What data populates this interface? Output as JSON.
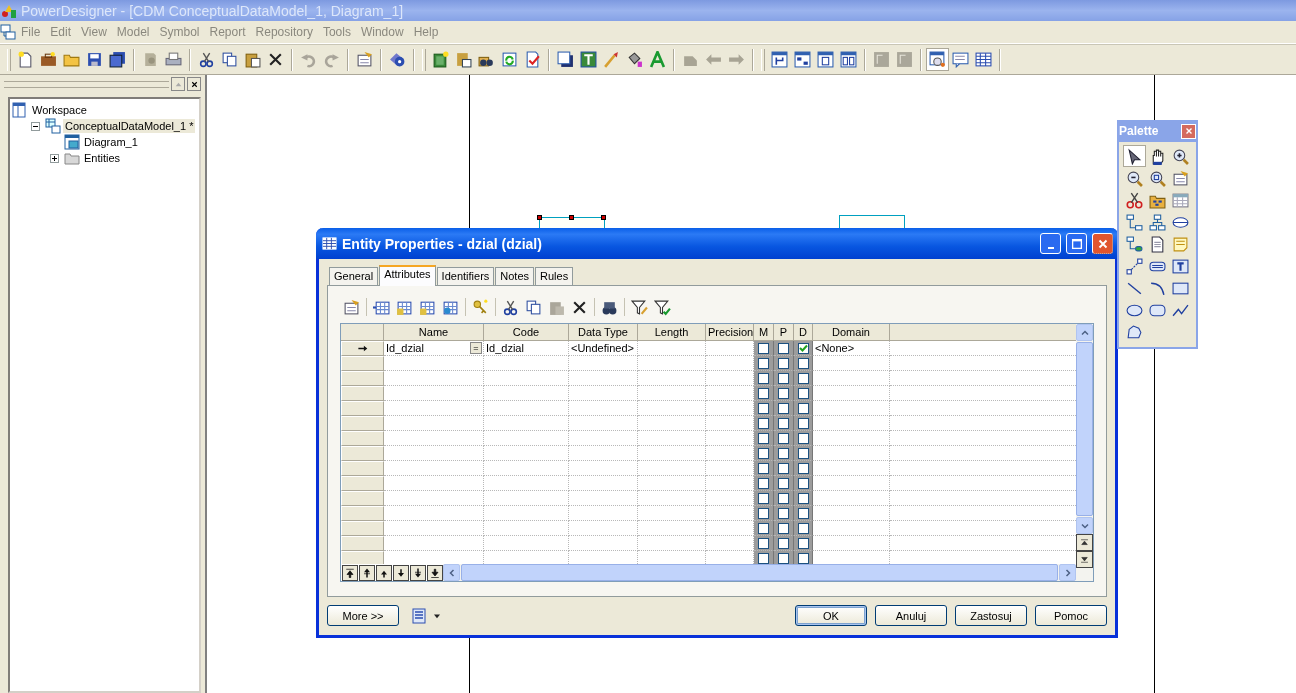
{
  "window": {
    "title": "PowerDesigner - [CDM ConceptualDataModel_1, Diagram_1]"
  },
  "menu": [
    "File",
    "Edit",
    "View",
    "Model",
    "Symbol",
    "Report",
    "Repository",
    "Tools",
    "Window",
    "Help"
  ],
  "workspace": {
    "items": [
      {
        "label": "Workspace",
        "selected": false,
        "children": [
          {
            "label": "ConceptualDataModel_1 *",
            "selected": true,
            "expanded": true,
            "children": [
              {
                "label": "Diagram_1",
                "selected": false
              },
              {
                "label": "Entities",
                "selected": false,
                "expanded": false
              }
            ]
          }
        ]
      }
    ]
  },
  "canvas": {
    "entities": [
      {
        "selected": true
      },
      {
        "selected": false
      }
    ]
  },
  "dialog": {
    "title": "Entity Properties - dzial (dzial)",
    "tabs": [
      {
        "label": "General",
        "selected": false
      },
      {
        "label": "Attributes",
        "selected": true
      },
      {
        "label": "Identifiers",
        "selected": false
      },
      {
        "label": "Notes",
        "selected": false
      },
      {
        "label": "Rules",
        "selected": false
      }
    ],
    "columns": [
      "Name",
      "Code",
      "Data Type",
      "Length",
      "Precision",
      "M",
      "P",
      "D",
      "Domain"
    ],
    "rows": [
      {
        "current": true,
        "name": "Id_dzial",
        "edit_button": "=",
        "code": "Id_dzial",
        "data_type": "<Undefined>",
        "m": false,
        "p": false,
        "d": true,
        "domain": "<None>"
      },
      {
        "current": false,
        "m": false,
        "p": false,
        "d": false
      },
      {
        "current": false,
        "m": false,
        "p": false,
        "d": false
      },
      {
        "current": false,
        "m": false,
        "p": false,
        "d": false
      },
      {
        "current": false,
        "m": false,
        "p": false,
        "d": false
      },
      {
        "current": false,
        "m": false,
        "p": false,
        "d": false
      },
      {
        "current": false,
        "m": false,
        "p": false,
        "d": false
      },
      {
        "current": false,
        "m": false,
        "p": false,
        "d": false
      },
      {
        "current": false,
        "m": false,
        "p": false,
        "d": false
      },
      {
        "current": false,
        "m": false,
        "p": false,
        "d": false
      },
      {
        "current": false,
        "m": false,
        "p": false,
        "d": false
      },
      {
        "current": false,
        "m": false,
        "p": false,
        "d": false
      },
      {
        "current": false,
        "m": false,
        "p": false,
        "d": false
      },
      {
        "current": false,
        "m": false,
        "p": false,
        "d": false
      },
      {
        "current": false,
        "m": false,
        "p": false,
        "d": false
      }
    ],
    "more_button": "More >>",
    "buttons": [
      {
        "label": "OK",
        "default": true
      },
      {
        "label": "Anuluj",
        "default": false
      },
      {
        "label": "Zastosuj",
        "default": false
      },
      {
        "label": "Pomoc",
        "default": false
      }
    ]
  },
  "palette": {
    "title": "Palette",
    "tools": [
      {
        "selected": true
      },
      {
        "selected": false
      },
      {
        "selected": false
      },
      {
        "selected": false
      },
      {
        "selected": false
      },
      {
        "selected": false
      },
      {
        "selected": false
      },
      {
        "selected": false
      },
      {
        "selected": false
      },
      {
        "selected": false
      },
      {
        "selected": false
      },
      {
        "selected": false
      },
      {
        "selected": false
      },
      {
        "selected": false
      },
      {
        "selected": false
      },
      {
        "selected": false
      },
      {
        "selected": false
      },
      {
        "selected": false
      },
      {
        "selected": false
      },
      {
        "selected": false
      },
      {
        "selected": false
      },
      {
        "selected": false
      },
      {
        "selected": false
      },
      {
        "selected": false
      },
      {
        "selected": false
      }
    ]
  }
}
